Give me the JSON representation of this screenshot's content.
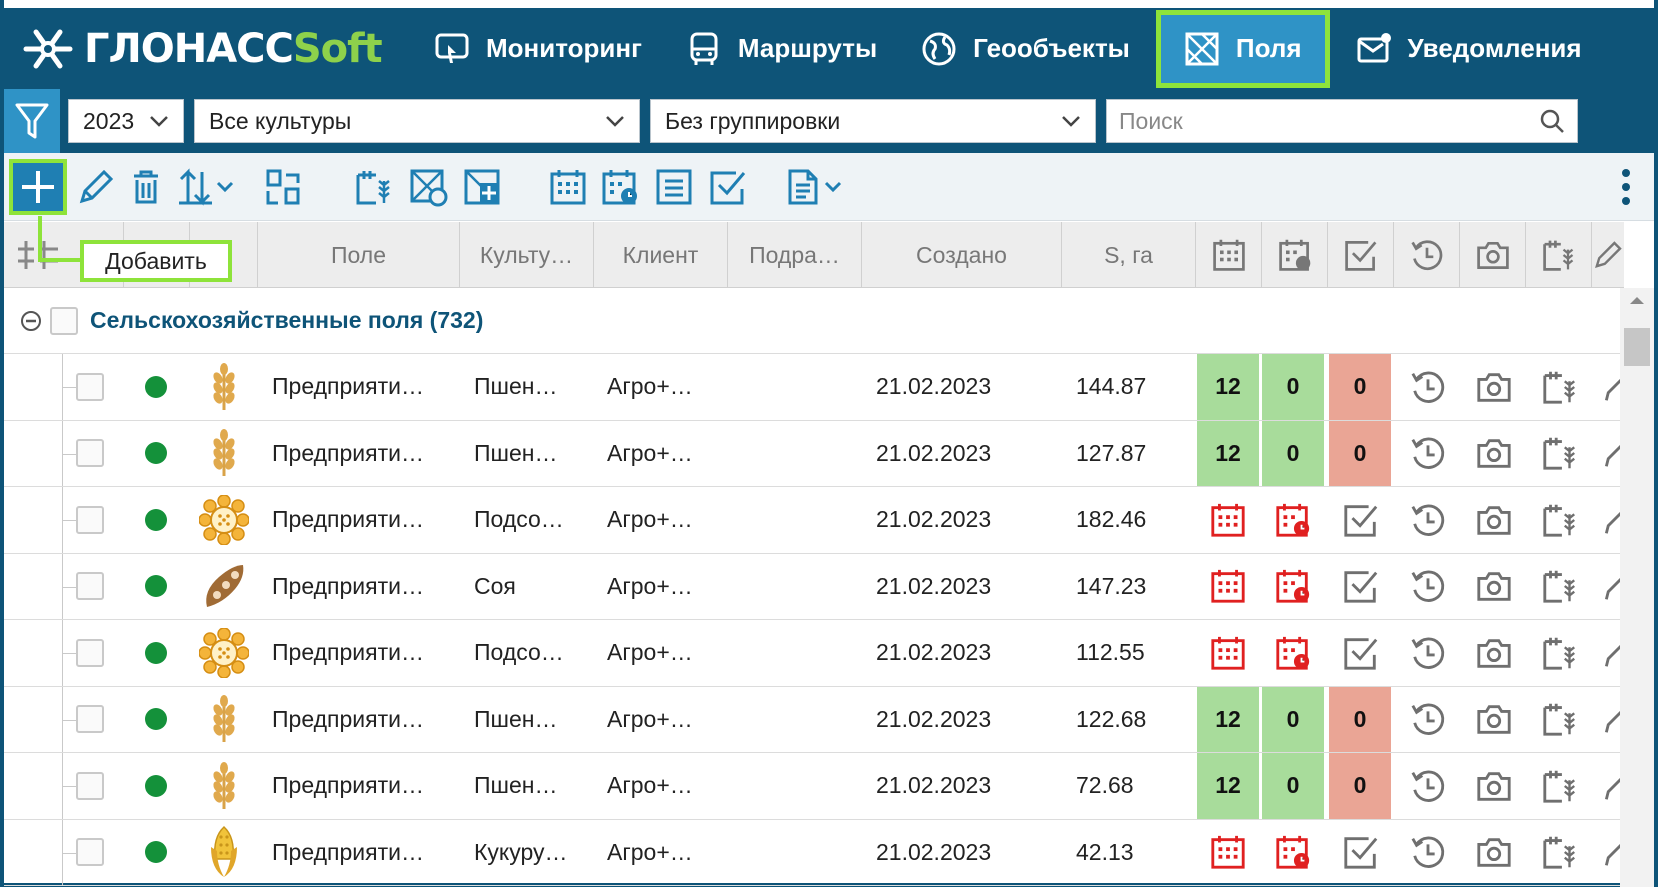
{
  "header": {
    "logo_main": "ГЛОНАСС",
    "logo_soft": "Soft",
    "nav": [
      {
        "label": "Мониторинг",
        "icon": "monitoring-icon"
      },
      {
        "label": "Маршруты",
        "icon": "bus-icon"
      },
      {
        "label": "Геообъекты",
        "icon": "globe-icon"
      },
      {
        "label": "Поля",
        "icon": "field-icon",
        "active": true
      },
      {
        "label": "Уведомления",
        "icon": "mail-icon"
      }
    ]
  },
  "filters": {
    "year": "2023",
    "culture": "Все культуры",
    "grouping": "Без группировки",
    "search_placeholder": "Поиск"
  },
  "tooltip": "Добавить",
  "columns": {
    "field": "Поле",
    "culture": "Культу…",
    "client": "Клиент",
    "division": "Подра…",
    "created": "Создано",
    "area": "S, га"
  },
  "group": {
    "title": "Сельскохозяйственные поля (732)"
  },
  "rows": [
    {
      "crop": "wheat",
      "field": "Предприяти…",
      "culture": "Пшен…",
      "client": "Агро+…",
      "created": "21.02.2023",
      "area": "144.87",
      "counts": [
        "12",
        "0",
        "0"
      ]
    },
    {
      "crop": "wheat",
      "field": "Предприяти…",
      "culture": "Пшен…",
      "client": "Агро+…",
      "created": "21.02.2023",
      "area": "127.87",
      "counts": [
        "12",
        "0",
        "0"
      ]
    },
    {
      "crop": "sunflower",
      "field": "Предприяти…",
      "culture": "Подсо…",
      "client": "Агро+…",
      "created": "21.02.2023",
      "area": "182.46",
      "counts": null
    },
    {
      "crop": "soy",
      "field": "Предприяти…",
      "culture": "Соя",
      "client": "Агро+…",
      "created": "21.02.2023",
      "area": "147.23",
      "counts": null
    },
    {
      "crop": "sunflower",
      "field": "Предприяти…",
      "culture": "Подсо…",
      "client": "Агро+…",
      "created": "21.02.2023",
      "area": "112.55",
      "counts": null
    },
    {
      "crop": "wheat",
      "field": "Предприяти…",
      "culture": "Пшен…",
      "client": "Агро+…",
      "created": "21.02.2023",
      "area": "122.68",
      "counts": [
        "12",
        "0",
        "0"
      ]
    },
    {
      "crop": "wheat",
      "field": "Предприяти…",
      "culture": "Пшен…",
      "client": "Агро+…",
      "created": "21.02.2023",
      "area": "72.68",
      "counts": [
        "12",
        "0",
        "0"
      ]
    },
    {
      "crop": "corn",
      "field": "Предприяти…",
      "culture": "Кукуру…",
      "client": "Агро+…",
      "created": "21.02.2023",
      "area": "42.13",
      "counts": null
    }
  ],
  "colors": {
    "brand": "#0e5478",
    "accent": "#2f93c6",
    "highlight": "#8ee33a",
    "green_cell": "#a8dc9b",
    "red_cell": "#eaa595",
    "alert_icon": "#e02020"
  }
}
